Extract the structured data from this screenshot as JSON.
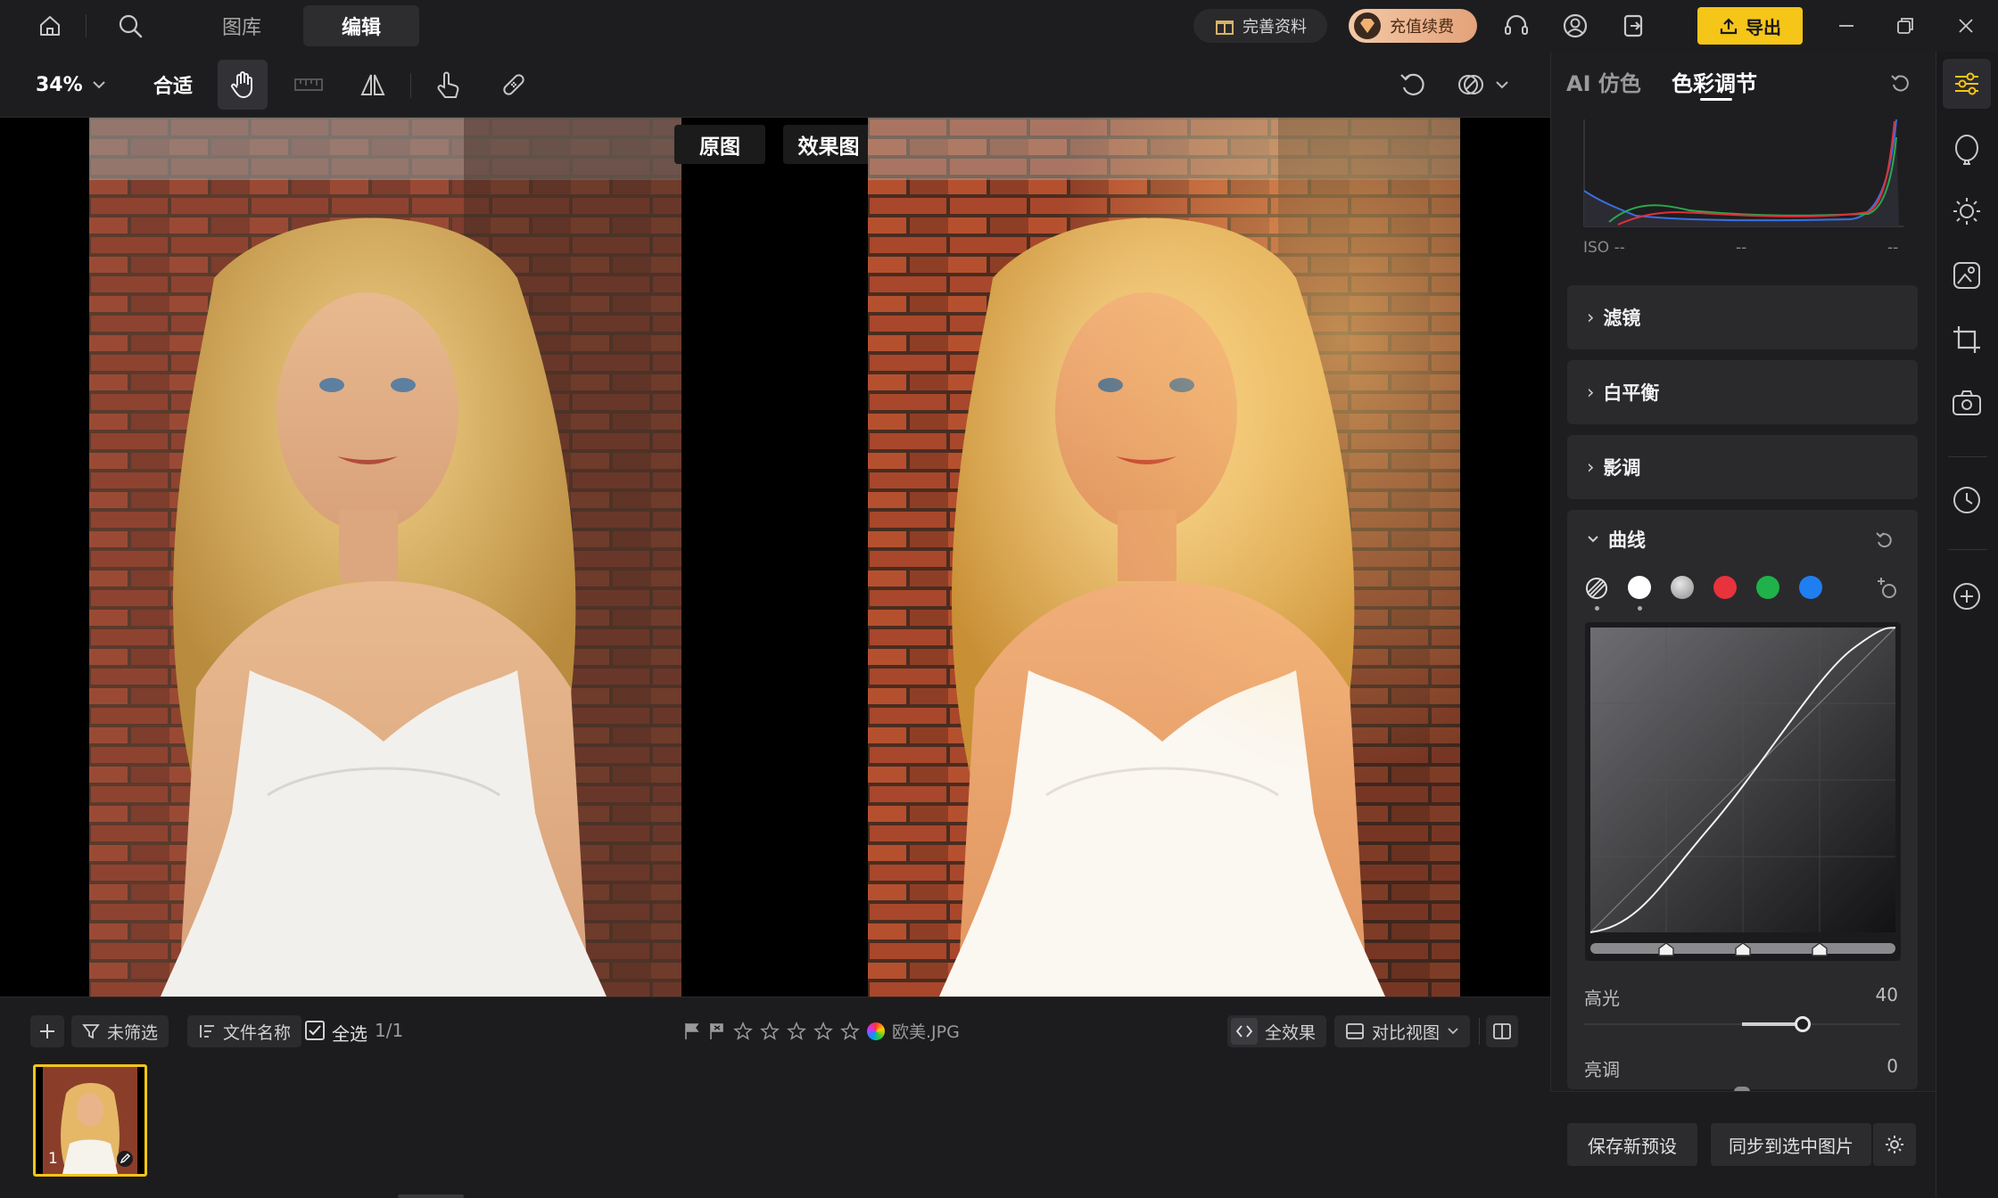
{
  "topbar": {
    "tabs": [
      {
        "label": "图库",
        "active": false
      },
      {
        "label": "编辑",
        "active": true
      }
    ],
    "complete_profile": "完善资料",
    "recharge": "充值续费",
    "export": "导出"
  },
  "toolbar": {
    "zoom": "34%",
    "fit": "合适"
  },
  "canvas": {
    "label_original": "原图",
    "label_effect": "效果图"
  },
  "panel": {
    "tabs": [
      {
        "label": "AI 仿色",
        "active": false
      },
      {
        "label": "色彩调节",
        "active": true
      }
    ],
    "histogram": {
      "iso": "ISO --",
      "mid": "--",
      "right": "--"
    },
    "sections": [
      {
        "label": "滤镜",
        "expanded": false
      },
      {
        "label": "白平衡",
        "expanded": false
      },
      {
        "label": "影调",
        "expanded": false
      },
      {
        "label": "曲线",
        "expanded": true
      }
    ],
    "curve_channels": [
      "luma",
      "white",
      "gray",
      "red",
      "green",
      "blue"
    ],
    "channel_colors": {
      "white": "#ffffff",
      "gray": "#bdbdbd",
      "red": "#e8323c",
      "green": "#1fb24a",
      "blue": "#1f7ff0"
    },
    "sliders": [
      {
        "label": "高光",
        "value": "40",
        "level": 0.4
      },
      {
        "label": "亮调",
        "value": "0",
        "level": 0
      }
    ],
    "save_preset": "保存新预设",
    "sync": "同步到选中图片"
  },
  "bottom": {
    "unfiltered": "未筛选",
    "filename": "文件名称",
    "select_all": "全选",
    "count": "1/1",
    "file": "欧美.JPG",
    "full_effect": "全效果",
    "compare_view": "对比视图",
    "thumb_index": "1"
  },
  "colors": {
    "accent": "#f5c518",
    "bg": "#1b1b1d"
  }
}
